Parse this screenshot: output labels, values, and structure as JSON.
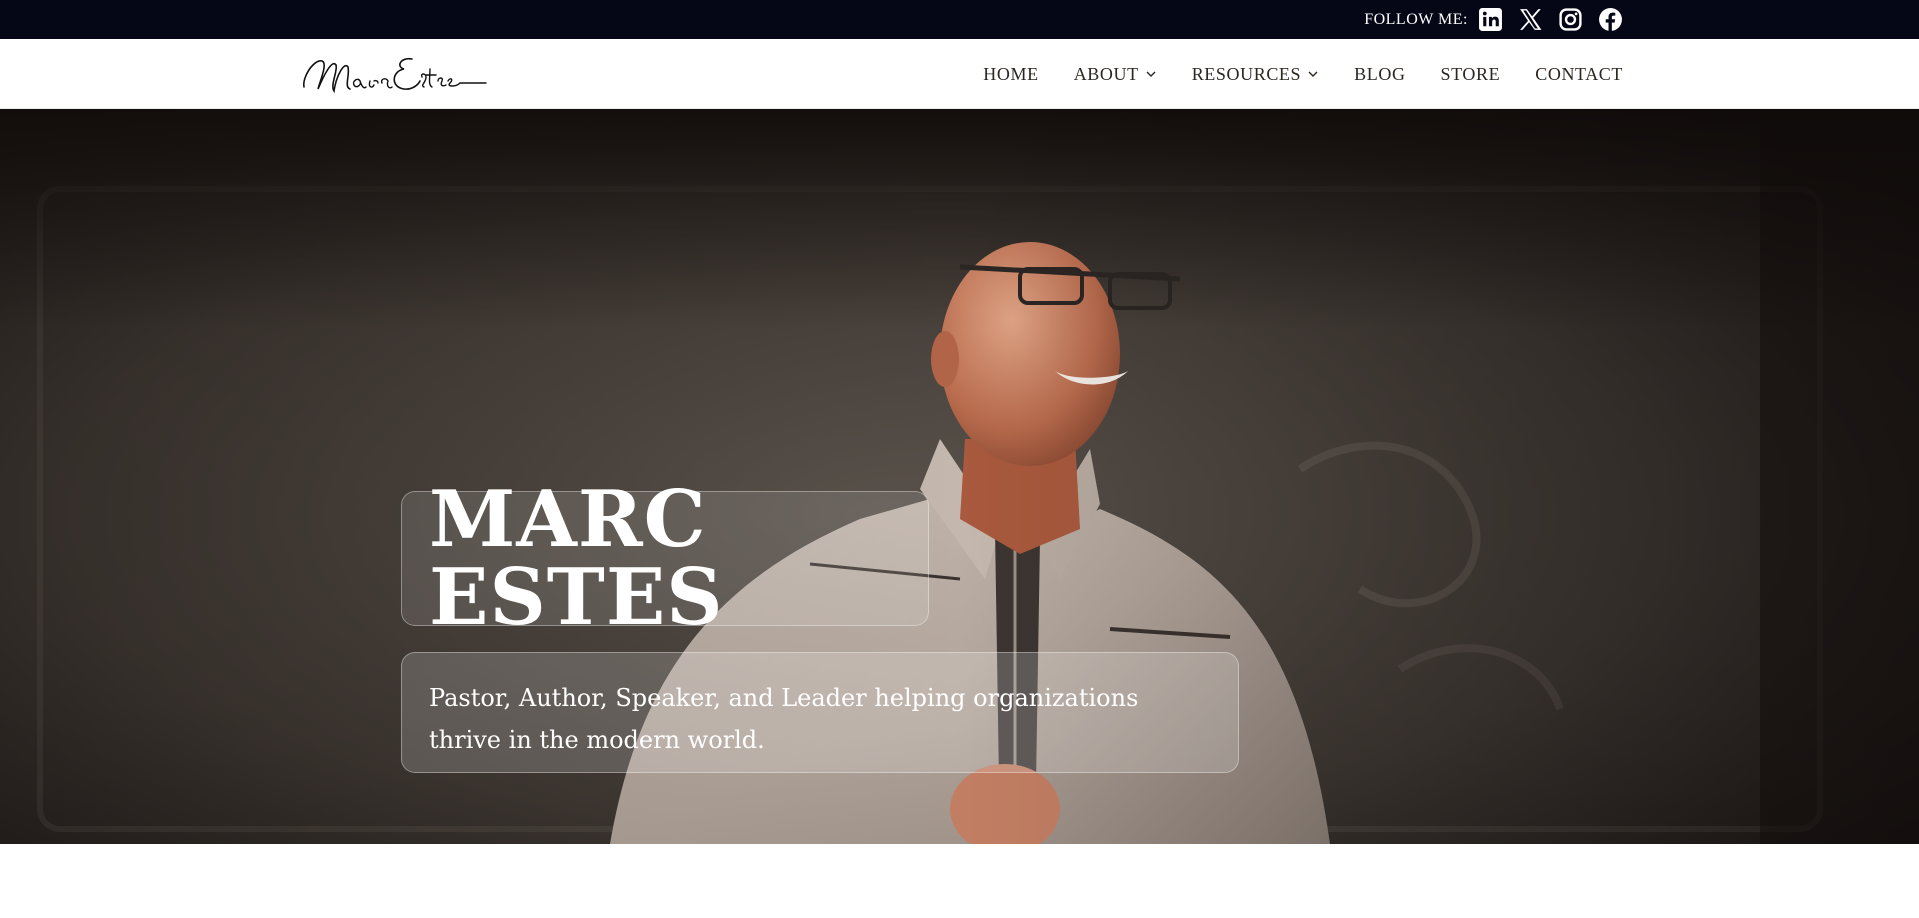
{
  "topbar": {
    "follow_label": "FOLLOW ME:",
    "social_icons": [
      "linkedin-icon",
      "x-icon",
      "instagram-icon",
      "facebook-icon"
    ],
    "background": "#050717"
  },
  "header": {
    "logo_text": "Marc Estes",
    "nav": {
      "home": "HOME",
      "about": "ABOUT",
      "resources": "RESOURCES",
      "blog": "BLOG",
      "store": "STORE",
      "contact": "CONTACT"
    }
  },
  "hero": {
    "title": "MARC ESTES",
    "subtitle": "Pastor, Author, Speaker, and Leader helping organizations thrive in the modern world.",
    "image_subject": "smiling bald man with glasses in light leather jacket on stage"
  }
}
